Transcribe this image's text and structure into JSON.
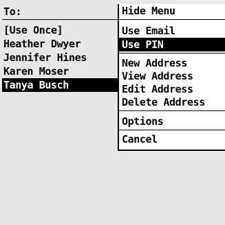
{
  "recipient": {
    "label": "To:",
    "items": [
      {
        "label": "[Use Once]"
      },
      {
        "label": "Heather Dwyer"
      },
      {
        "label": "Jennifer Hines"
      },
      {
        "label": "Karen Moser"
      },
      {
        "label": "Tanya Busch"
      }
    ],
    "selected_label": "Tanya Busch"
  },
  "menu": {
    "hide": "Hide Menu",
    "use_email": "Use Email",
    "use_pin": "Use PIN",
    "new_address": "New Address",
    "view_address": "View Address",
    "edit_address": "Edit Address",
    "delete_address": "Delete Address",
    "options": "Options",
    "cancel": "Cancel",
    "highlighted_label": "Use PIN"
  },
  "colors": {
    "background": "#e7e7e7",
    "menu_background": "#ffffff",
    "highlight": "#000000",
    "highlight_text": "#ffffff"
  }
}
